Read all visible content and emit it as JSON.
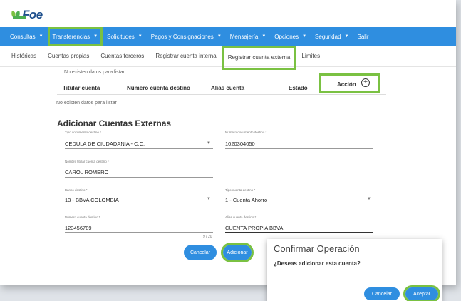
{
  "brand": {
    "logo_text": "Foe"
  },
  "nav": {
    "items": [
      {
        "label": "Consultas",
        "caret": true,
        "active": false
      },
      {
        "label": "Transferencias",
        "caret": true,
        "active": true
      },
      {
        "label": "Solicitudes",
        "caret": true,
        "active": false
      },
      {
        "label": "Pagos y Consignaciones",
        "caret": true,
        "active": false
      },
      {
        "label": "Mensajería",
        "caret": true,
        "active": false
      },
      {
        "label": "Opciones",
        "caret": true,
        "active": false
      },
      {
        "label": "Seguridad",
        "caret": true,
        "active": false
      },
      {
        "label": "Salir",
        "caret": false,
        "active": false
      }
    ]
  },
  "subnav": {
    "items": [
      {
        "label": "Históricas",
        "active": false
      },
      {
        "label": "Cuentas propias",
        "active": false
      },
      {
        "label": "Cuentas terceros",
        "active": false
      },
      {
        "label": "Registrar cuenta interna",
        "active": false
      },
      {
        "label": "Registrar cuenta externa",
        "active": true
      },
      {
        "label": "Límites",
        "active": false
      }
    ]
  },
  "content": {
    "no_data_top": "No existen datos para listar",
    "table": {
      "headers": [
        "Titular cuenta",
        "Número cuenta destino",
        "Alias cuenta",
        "Estado",
        "Acción"
      ]
    },
    "no_data_bottom": "No existen datos para listar"
  },
  "form": {
    "title": "Adicionar Cuentas Externas",
    "tipo_documento": {
      "label": "Tipo documento destino *",
      "value": "CEDULA DE CIUDADANIA - C.C."
    },
    "numero_documento": {
      "label": "Número documento destino *",
      "value": "1020304050"
    },
    "nombre_titular": {
      "label": "Nombre titular cuenta destino *",
      "value": "CAROL ROMERO"
    },
    "banco": {
      "label": "Banco destino *",
      "value": "13 - BBVA COLOMBIA"
    },
    "tipo_cuenta": {
      "label": "Tipo cuenta destino *",
      "value": "1 - Cuenta Ahorro"
    },
    "numero_cuenta": {
      "label": "Número cuenta destino *",
      "value": "123456789",
      "counter": "9 / 20"
    },
    "alias": {
      "label": "Alias cuenta destino *",
      "value": "CUENTA PROPIA BBVA"
    },
    "cancel_label": "Cancelar",
    "add_label": "Adicionar"
  },
  "modal": {
    "title": "Confirmar Operación",
    "message": "¿Deseas adicionar esta cuenta?",
    "cancel_label": "Cancelar",
    "accept_label": "Aceptar"
  },
  "colors": {
    "primary": "#2f8ee0",
    "highlight": "#7ac142",
    "brand_text": "#1d4f8c"
  }
}
